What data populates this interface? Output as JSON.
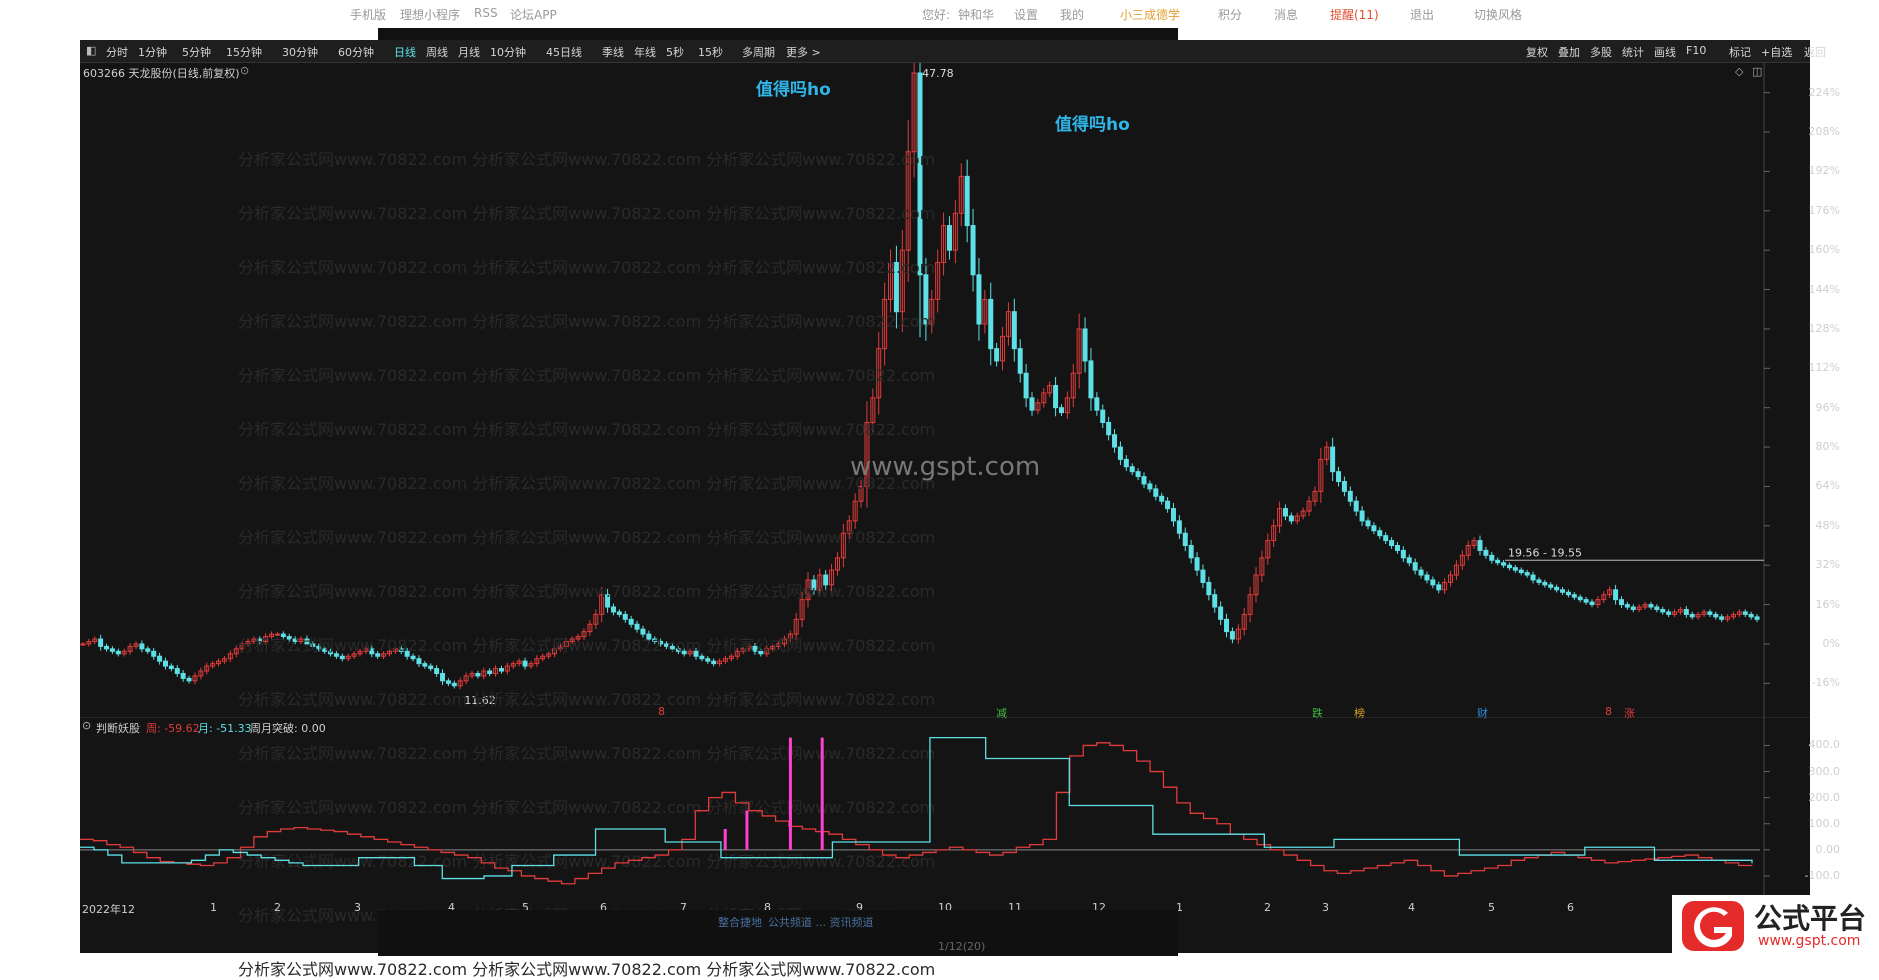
{
  "topbar": {
    "items": [
      "手机版",
      "理想小程序",
      "RSS",
      "论坛APP"
    ],
    "user": [
      "您好:",
      "钟和华",
      "设置",
      "我的",
      "小三成德学",
      "积分",
      "消息",
      "提醒(11)",
      "退出",
      "切换风格"
    ]
  },
  "timeframes": [
    "分时",
    "1分钟",
    "5分钟",
    "15分钟",
    "30分钟",
    "60分钟",
    "日线",
    "周线",
    "月线",
    "10分钟",
    "45日线",
    "季线",
    "年线",
    "5秒",
    "15秒",
    "多周期",
    "更多 >"
  ],
  "active_timeframe": "日线",
  "right_tools": [
    "复权",
    "叠加",
    "多股",
    "统计",
    "画线",
    "F10",
    "标记",
    "+自选",
    "返回"
  ],
  "stock_header": "603266 天龙股份(日线,前复权)",
  "notes": {
    "left": "值得吗ho",
    "peak": "值得吗ho"
  },
  "price_labels": {
    "max": "47.78",
    "min": "11.62",
    "range": "19.56 - 19.55"
  },
  "watermark_big": "www.gspt.com",
  "watermark_row": "分析家公式网www.70822.com 分析家公式网www.70822.com 分析家公式网www.70822.com",
  "markers": [
    "8",
    "减",
    "跌",
    "榜",
    "财",
    "8",
    "涨"
  ],
  "indicator": {
    "name": "判断妖股",
    "week_label": "周: -59.62",
    "month_label": "月: -51.33",
    "break_label": "周月突破: 0.00"
  },
  "footer": {
    "left_text": "整合捷地",
    "mid_text": "公共频道 ... 资讯频道",
    "page": "1/12(20)"
  },
  "logo": {
    "big": "公式平台",
    "small": "www.gspt.com"
  },
  "colors": {
    "up": "#e23b3b",
    "down": "#5de0e6",
    "bg": "#141414",
    "accent": "#2fb5e8",
    "magenta": "#ff3fd0"
  },
  "chart_data": {
    "type": "candlestick",
    "x_labels": [
      "2022年12",
      "1",
      "2",
      "3",
      "4",
      "5",
      "6",
      "7",
      "8",
      "9",
      "10",
      "11",
      "12",
      "1",
      "2",
      "3",
      "4",
      "5",
      "6"
    ],
    "y_ticks": [
      "224%",
      "208%",
      "192%",
      "176%",
      "160%",
      "144%",
      "128%",
      "112%",
      "96%",
      "80%",
      "64%",
      "48%",
      "32%",
      "16%",
      "0%",
      "-16%"
    ],
    "y_pct_range": [
      -24,
      232
    ],
    "close_pct": [
      0,
      1,
      2,
      -1,
      -2,
      -3,
      -4,
      -3,
      -1,
      0,
      -2,
      -3,
      -5,
      -7,
      -9,
      -10,
      -12,
      -14,
      -15,
      -13,
      -11,
      -9,
      -8,
      -7,
      -6,
      -4,
      -2,
      0,
      1,
      2,
      1,
      3,
      4,
      4,
      3,
      2,
      1,
      2,
      0,
      -1,
      -2,
      -3,
      -4,
      -5,
      -6,
      -5,
      -4,
      -3,
      -2,
      -4,
      -5,
      -4,
      -3,
      -2,
      -3,
      -5,
      -6,
      -8,
      -9,
      -10,
      -12,
      -15,
      -16,
      -17,
      -15,
      -13,
      -12,
      -13,
      -11,
      -12,
      -10,
      -11,
      -9,
      -8,
      -7,
      -9,
      -8,
      -6,
      -5,
      -4,
      -2,
      -1,
      1,
      2,
      3,
      5,
      8,
      12,
      20,
      15,
      13,
      12,
      10,
      8,
      6,
      4,
      2,
      1,
      0,
      -1,
      -2,
      -3,
      -4,
      -3,
      -5,
      -6,
      -7,
      -8,
      -7,
      -6,
      -5,
      -3,
      -2,
      -1,
      -3,
      -4,
      -2,
      -1,
      0,
      2,
      4,
      10,
      18,
      26,
      22,
      28,
      24,
      30,
      35,
      45,
      50,
      58,
      64,
      90,
      100,
      120,
      140,
      155,
      135,
      160,
      200,
      232,
      150,
      130,
      140,
      155,
      170,
      160,
      175,
      190,
      170,
      150,
      130,
      140,
      120,
      115,
      125,
      135,
      120,
      110,
      100,
      95,
      98,
      102,
      105,
      96,
      94,
      100,
      110,
      128,
      115,
      100,
      95,
      90,
      85,
      80,
      75,
      72,
      70,
      68,
      65,
      63,
      60,
      58,
      55,
      50,
      45,
      40,
      35,
      30,
      25,
      20,
      15,
      10,
      5,
      2,
      6,
      12,
      20,
      28,
      35,
      42,
      48,
      55,
      52,
      50,
      52,
      54,
      58,
      62,
      75,
      80,
      70,
      66,
      62,
      58,
      54,
      50,
      48,
      46,
      44,
      42,
      40,
      38,
      35,
      33,
      30,
      28,
      26,
      24,
      22,
      25,
      28,
      32,
      36,
      40,
      42,
      38,
      36,
      34,
      33,
      32,
      31,
      30,
      29,
      28,
      26,
      25,
      24,
      23,
      22,
      21,
      20,
      19,
      18,
      17,
      16,
      18,
      20,
      22,
      18,
      16,
      15,
      14,
      15,
      16,
      15,
      14,
      13,
      12,
      13,
      14,
      12,
      11,
      12,
      13,
      12,
      11,
      10,
      11,
      12,
      13,
      12,
      11,
      10
    ],
    "price_max": 47.78,
    "price_min": 11.62,
    "indicator_y_ticks": [
      "400.0",
      "300.0",
      "200.0",
      "100.0",
      "0.00",
      "-100.0"
    ],
    "indicator_range": [
      -150,
      440
    ],
    "week_series": [
      40,
      35,
      20,
      10,
      -10,
      -30,
      -45,
      -50,
      -55,
      -60,
      -50,
      -30,
      10,
      50,
      70,
      80,
      85,
      80,
      75,
      70,
      60,
      50,
      40,
      30,
      20,
      10,
      0,
      -10,
      -20,
      -30,
      -50,
      -70,
      -80,
      -100,
      -110,
      -120,
      -130,
      -110,
      -90,
      -70,
      -50,
      -40,
      -30,
      -20,
      0,
      40,
      150,
      200,
      220,
      180,
      150,
      130,
      110,
      90,
      80,
      70,
      60,
      40,
      20,
      0,
      -20,
      -30,
      -20,
      -10,
      0,
      10,
      0,
      -10,
      -20,
      -10,
      10,
      20,
      40,
      220,
      360,
      400,
      410,
      400,
      380,
      340,
      300,
      240,
      180,
      140,
      120,
      100,
      60,
      40,
      20,
      0,
      -20,
      -40,
      -60,
      -80,
      -90,
      -80,
      -70,
      -60,
      -50,
      -40,
      -60,
      -80,
      -100,
      -90,
      -80,
      -70,
      -60,
      -40,
      -30,
      -20,
      -10,
      -20,
      -30,
      -40,
      -50,
      -45,
      -40,
      -35,
      -30,
      -25,
      -20,
      -30,
      -40,
      -50,
      -60,
      -59.62
    ],
    "month_series": [
      10,
      0,
      -20,
      -50,
      -50,
      -50,
      -50,
      -50,
      -40,
      -20,
      0,
      -10,
      -20,
      -30,
      -40,
      -50,
      -60,
      -60,
      -60,
      -60,
      -30,
      -30,
      -30,
      -30,
      -60,
      -60,
      -110,
      -110,
      -110,
      -100,
      -100,
      -60,
      -60,
      -60,
      -20,
      -20,
      -20,
      80,
      80,
      80,
      80,
      80,
      30,
      30,
      30,
      30,
      -30,
      -30,
      -30,
      -30,
      -30,
      -30,
      -30,
      -30,
      30,
      30,
      30,
      30,
      30,
      30,
      30,
      430,
      430,
      430,
      430,
      350,
      350,
      350,
      350,
      350,
      350,
      170,
      170,
      170,
      170,
      170,
      170,
      60,
      60,
      60,
      60,
      60,
      60,
      60,
      60,
      10,
      10,
      10,
      10,
      10,
      40,
      40,
      40,
      40,
      40,
      40,
      40,
      40,
      40,
      -20,
      -20,
      -20,
      -20,
      -20,
      -20,
      -20,
      -20,
      -20,
      10,
      10,
      10,
      10,
      10,
      -40,
      -40,
      -40,
      -40,
      -40,
      -40,
      -40,
      -51.33
    ]
  }
}
